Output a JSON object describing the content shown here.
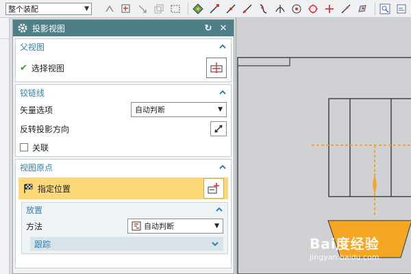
{
  "toolbar": {
    "assembly_filter": "整个装配"
  },
  "dialog": {
    "title": "投影视图",
    "parent_view": {
      "header": "父视图",
      "select_label": "选择视图"
    },
    "hinge_line": {
      "header": "铰链线",
      "vector_label": "矢量选项",
      "vector_value": "自动判断",
      "reverse_label": "反转投影方向",
      "associate_label": "关联"
    },
    "view_origin": {
      "header": "视图原点",
      "specify_label": "指定位置",
      "placement": {
        "header": "放置",
        "method_label": "方法",
        "method_value": "自动判断",
        "track_label": "跟踪"
      }
    }
  },
  "watermark": {
    "brand": "Bai度经验",
    "url": "jingyan.baidu.com"
  },
  "colors": {
    "title_bar": "#4f7f86",
    "section_header_text": "#2f7fb0",
    "highlight_row": "#fcd978",
    "projection_orange": "#f5a623"
  }
}
